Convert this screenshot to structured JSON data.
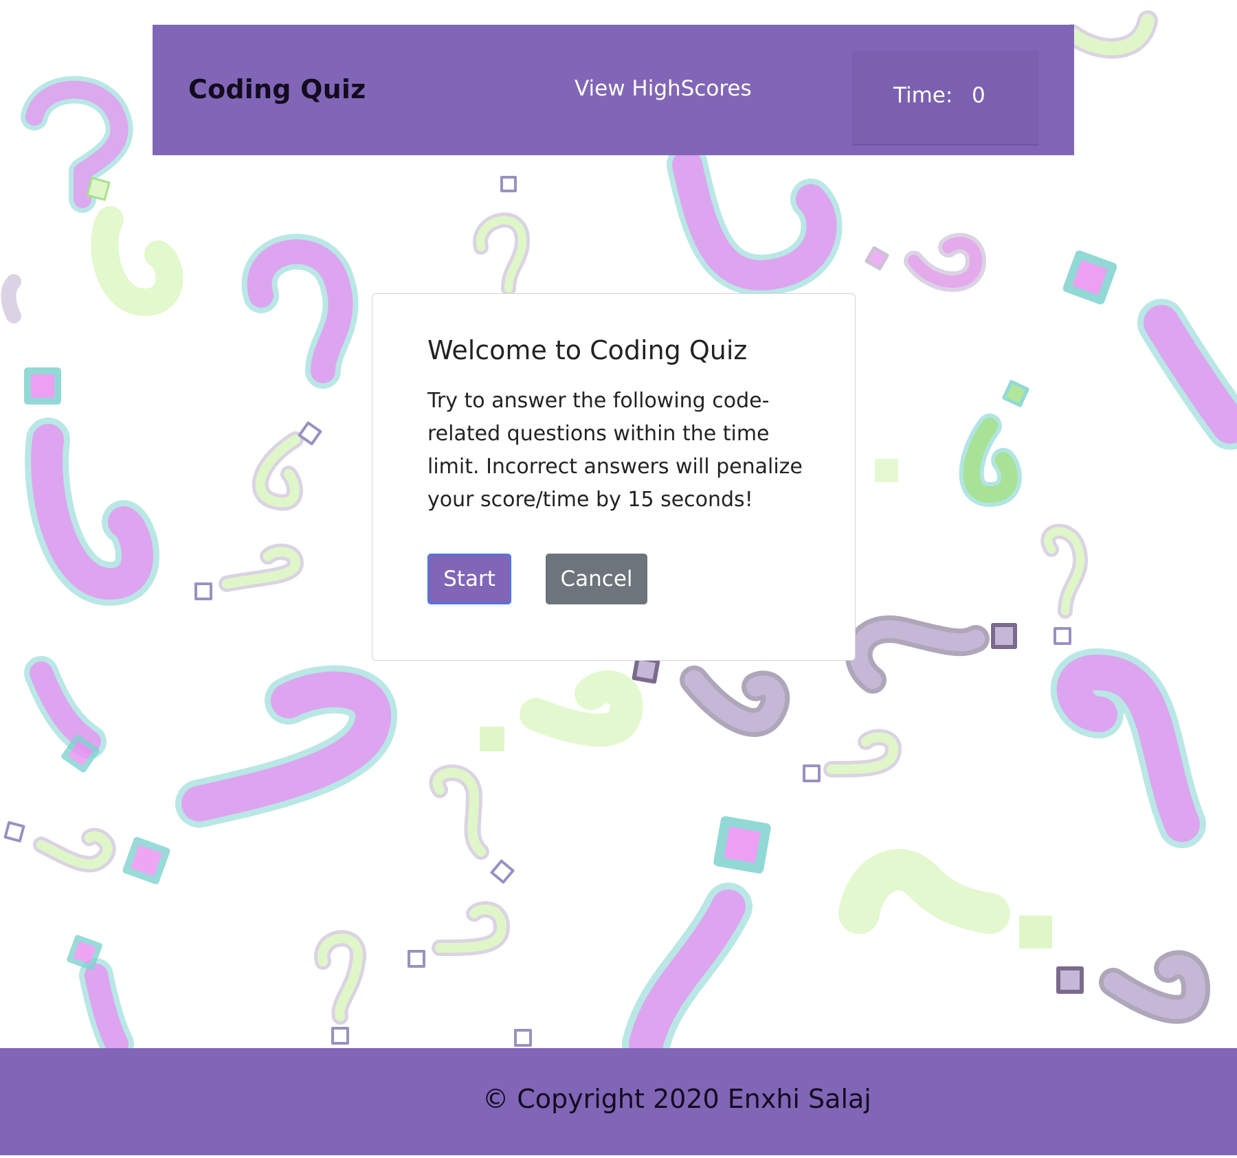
{
  "header": {
    "brand": "Coding Quiz",
    "highscores_link": "View HighScores",
    "timer_label": "Time:",
    "timer_value": "0"
  },
  "modal": {
    "title": "Welcome to Coding Quiz",
    "body": "Try to answer the following code-related questions within the time limit. Incorrect answers will penalize your score/time by 15 seconds!",
    "start_label": "Start",
    "cancel_label": "Cancel"
  },
  "footer": {
    "copyright": "© Copyright 2020 Enxhi Salaj"
  },
  "background": {
    "icon": "question-mark-pattern",
    "colors": [
      "#ea8ff2",
      "#7fd3cf",
      "#dff7c8",
      "#b8a8c8",
      "#a4e28a"
    ]
  },
  "colors": {
    "accent": "#8166b7",
    "cancel": "#6d747b",
    "start_border": "#3d7bf2"
  }
}
